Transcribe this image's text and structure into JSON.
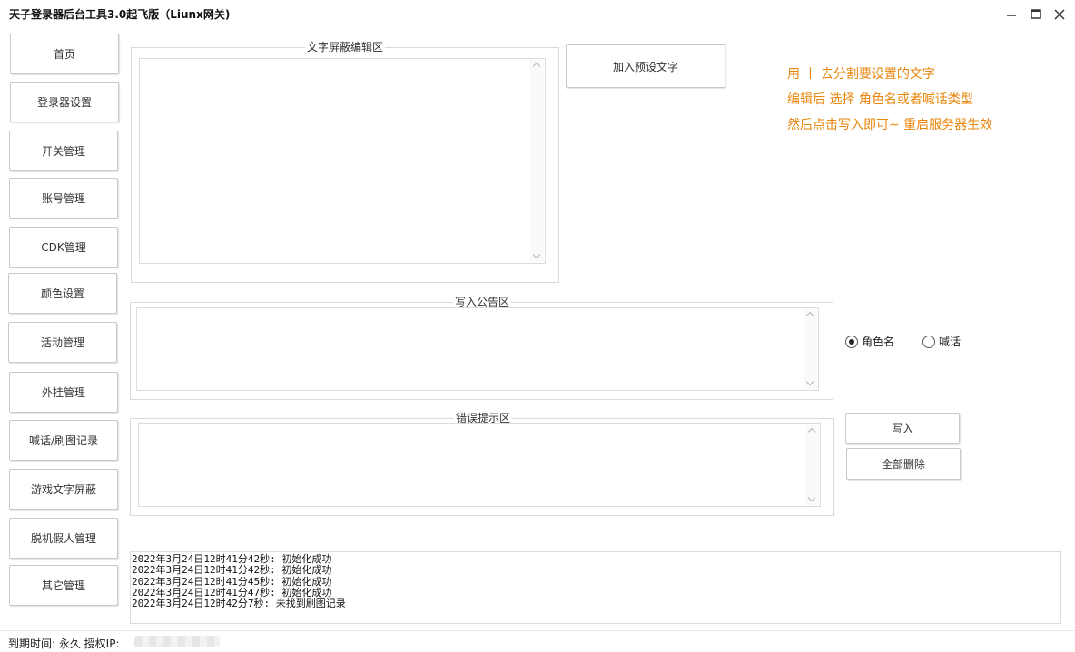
{
  "window": {
    "title": "天子登录器后台工具3.0起飞版（Liunx网关)",
    "controls": [
      "minimize-icon",
      "maximize-icon",
      "close-icon"
    ]
  },
  "sidebar": {
    "items": [
      {
        "label": "首页"
      },
      {
        "label": "登录器设置"
      },
      {
        "label": "开关管理"
      },
      {
        "label": "账号管理"
      },
      {
        "label": "CDK管理"
      },
      {
        "label": "颜色设置"
      },
      {
        "label": "活动管理"
      },
      {
        "label": "外挂管理"
      },
      {
        "label": "喊话/刷图记录"
      },
      {
        "label": "游戏文字屏蔽"
      },
      {
        "label": "脱机假人管理"
      },
      {
        "label": "其它管理"
      }
    ]
  },
  "main": {
    "filter_group": {
      "title": "文字屏蔽编辑区",
      "value": ""
    },
    "preset_button": "加入预设文字",
    "hints": [
      "用 丨 去分割要设置的文字",
      "编辑后 选择 角色名或者喊话类型",
      "然后点击写入即可~  重启服务器生效"
    ],
    "announce_group": {
      "title": "写入公告区",
      "value": ""
    },
    "radio": {
      "options": [
        "角色名",
        "喊话"
      ],
      "selected": "角色名"
    },
    "error_group": {
      "title": "错误提示区",
      "value": ""
    },
    "write_button": "写入",
    "delete_all_button": "全部删除",
    "log": [
      "2022年3月24日12时41分42秒: 初始化成功",
      "2022年3月24日12时41分42秒: 初始化成功",
      "2022年3月24日12时41分45秒: 初始化成功",
      "2022年3月24日12时41分47秒: 初始化成功",
      "2022年3月24日12时42分7秒: 未找到刷图记录"
    ]
  },
  "status": {
    "text": "到期时间: 永久  授权IP:"
  },
  "colors": {
    "hint": "#e8860c",
    "border": "#d9d9d9"
  }
}
